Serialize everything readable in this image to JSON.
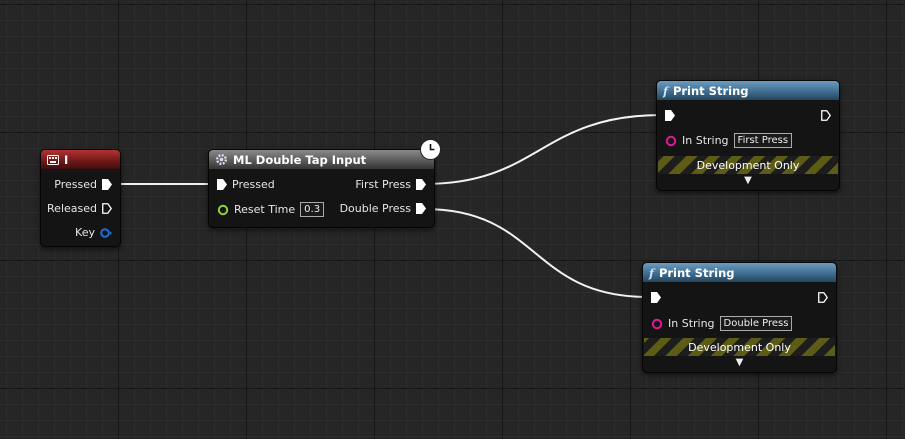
{
  "colors": {
    "exec_pin": "#ffffff",
    "float_pin": "#8fd140",
    "struct_pin": "#1f6fd6",
    "string_pin": "#e0189a",
    "wire": "#f2f2f2"
  },
  "nodes": {
    "key_event": {
      "title": "I",
      "icon": "keyboard-icon",
      "pins": {
        "pressed": "Pressed",
        "released": "Released",
        "key": "Key"
      }
    },
    "double_tap": {
      "title": "ML Double Tap Input",
      "icon": "macro-gear-icon",
      "badge_icon": "clock-icon",
      "pins": {
        "pressed": "Pressed",
        "reset_time": "Reset Time",
        "reset_time_value": "0.3",
        "first_press": "First Press",
        "double_press": "Double Press"
      }
    },
    "print1": {
      "title": "Print String",
      "icon": "function-icon",
      "in_string_label": "In String",
      "in_string_value": "First Press",
      "dev_only": "Development Only",
      "expand_glyph": "▼"
    },
    "print2": {
      "title": "Print String",
      "icon": "function-icon",
      "in_string_label": "In String",
      "in_string_value": "Double Press",
      "dev_only": "Development Only",
      "expand_glyph": "▼"
    }
  }
}
